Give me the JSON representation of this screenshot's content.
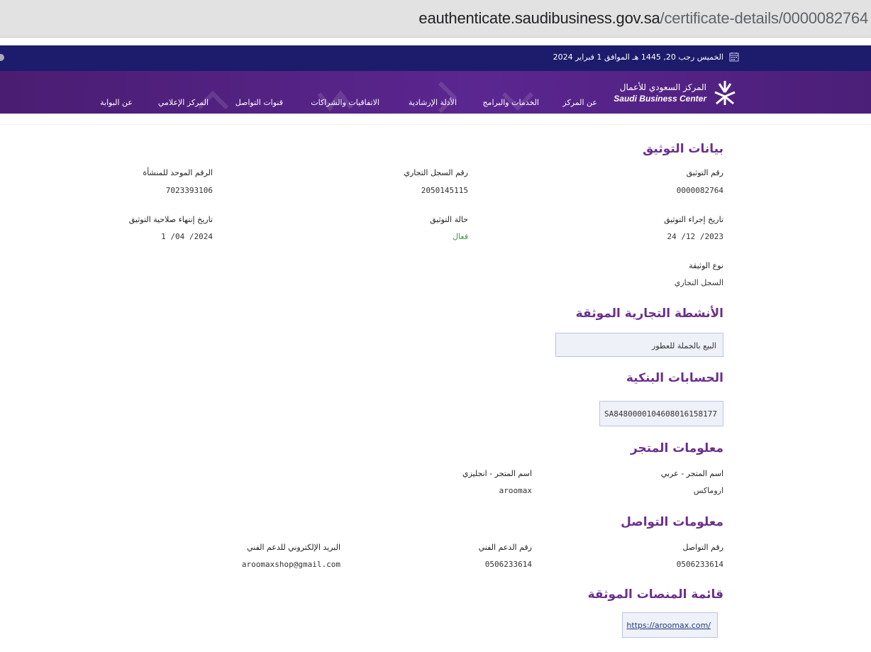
{
  "browser": {
    "url_host": "eauthenticate.saudibusiness.gov.sa",
    "url_path": "/certificate-details/0000082764"
  },
  "topbar": {
    "date": "الخميس رجب 20, 1445 هـ الموافق 1 فبراير 2024",
    "calendar_icon": "calendar-icon"
  },
  "header": {
    "logo_ar": "المركز السعودي للأعمال",
    "logo_en": "Saudi Business Center",
    "nav": [
      "عن المركز",
      "الخدمات والبرامج",
      "الأدلة الإرشادية",
      "الاتفاقيات والشراكات",
      "قنوات التواصل",
      "المركز الإعلامي",
      "عن البوابة"
    ],
    "colors": {
      "datebar": "#1d1b6b",
      "navbar": "#5b2690",
      "heading": "#6a2f8e",
      "active": "#2e9b3a"
    }
  },
  "auth": {
    "title": "بيانات التوثيق",
    "auth_no_label": "رقم التوثيق",
    "auth_no": "0000082764",
    "cr_label": "رقم السجل التجاري",
    "cr_no": "2050145115",
    "unified_label": "الرقم الموحد للمنشأة",
    "unified_no": "7023393106",
    "date_label": "تاريخ إجراء التوثيق",
    "date": "2023/ 12/ 24",
    "status_label": "حالة التوثيق",
    "status": "فعال",
    "expiry_label": "تاريخ إنتهاء صلاحية التوثيق",
    "expiry": "2024/ 04/ 1",
    "doc_type_label": "نوع الوثيقة",
    "doc_type": "السجل التجاري"
  },
  "activities": {
    "title": "الأنشطة التجارية الموثقة",
    "items": [
      "البيع بالجملة للعطور"
    ]
  },
  "bank": {
    "title": "الحسابات البنكية",
    "iban": "SA8480000104608016158177"
  },
  "store": {
    "title": "معلومات المتجر",
    "name_ar_label": "اسم المتجر - عربي",
    "name_ar": "اروماكس",
    "name_en_label": "اسم المتجر - انجليزي",
    "name_en": "aroomax"
  },
  "contact": {
    "title": "معلومات التواصل",
    "phone_label": "رقم التواصل",
    "phone": "0506233614",
    "support_label": "رقم الدعم الفني",
    "support": "0506233614",
    "email_label": "البريد الإلكتروني للدعم الفني",
    "email": "aroomaxshop@gmail.com"
  },
  "platforms": {
    "title": "قائمة المنصات الموثقة",
    "links": [
      "https://aroomax.com/"
    ]
  }
}
